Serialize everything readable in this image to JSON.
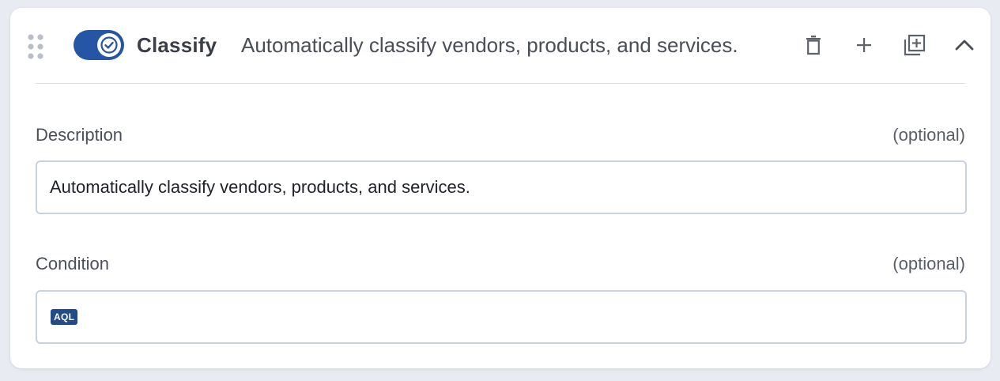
{
  "rule": {
    "enabled": true,
    "title": "Classify",
    "subtitle": "Automatically classify vendors, products, and services.",
    "actions": [
      "trash-icon",
      "plus-icon",
      "duplicate-icon",
      "chevron-up-icon"
    ]
  },
  "description": {
    "label": "Description",
    "optional": "(optional)",
    "value": "Automatically classify vendors, products, and services."
  },
  "condition": {
    "label": "Condition",
    "optional": "(optional)",
    "badge": "AQL",
    "value": ""
  },
  "colors": {
    "accent": "#2556a6",
    "badge": "#234a8a",
    "border": "#c9d1e0",
    "background": "#e8ebf2"
  }
}
